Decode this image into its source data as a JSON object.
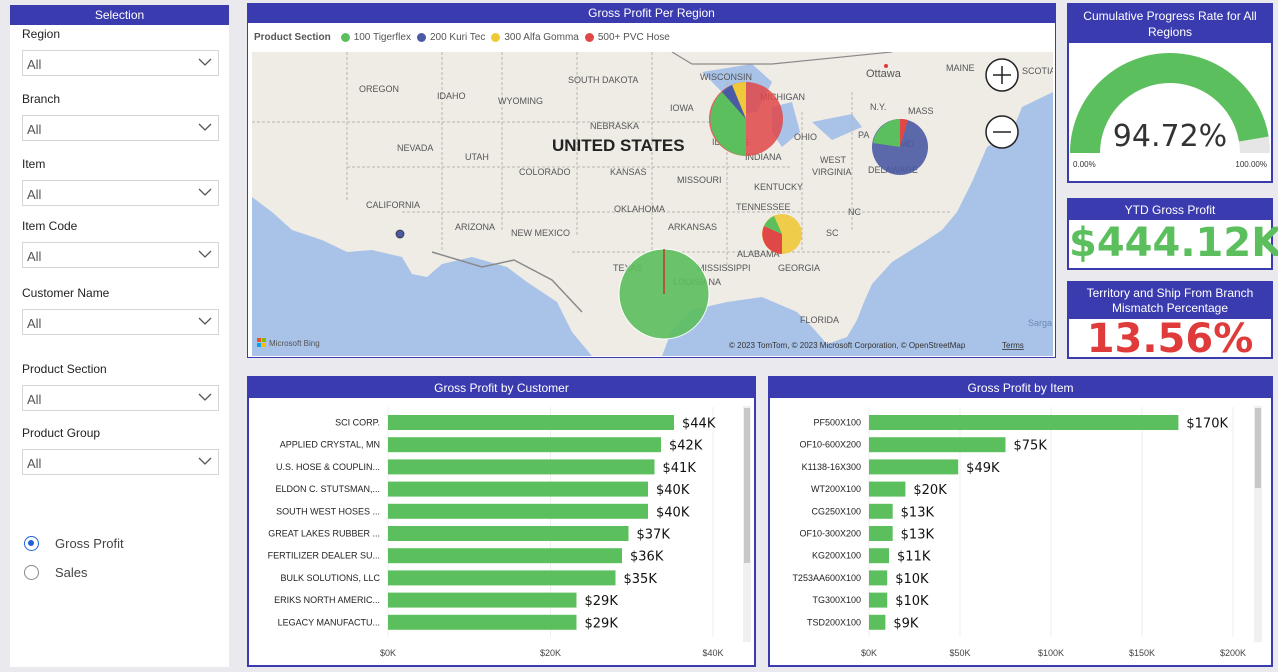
{
  "selection": {
    "title": "Selection",
    "slicers": [
      {
        "label": "Region",
        "value": "All"
      },
      {
        "label": "Branch",
        "value": "All"
      },
      {
        "label": "Item",
        "value": "All"
      },
      {
        "label": "Item Code",
        "value": "All"
      },
      {
        "label": "Customer Name",
        "value": "All"
      },
      {
        "label": "Product Section",
        "value": "All"
      },
      {
        "label": "Product Group",
        "value": "All"
      }
    ],
    "radios": [
      {
        "label": "Gross Profit",
        "selected": true
      },
      {
        "label": "Sales",
        "selected": false
      }
    ]
  },
  "map": {
    "title": "Gross Profit Per Region",
    "legend_title": "Product Section",
    "legend": [
      {
        "label": "100 Tigerflex",
        "color": "#5cbf5e"
      },
      {
        "label": "200 Kuri Tec",
        "color": "#4a5aa3"
      },
      {
        "label": "300 Alfa Gomma",
        "color": "#f0c93a"
      },
      {
        "label": "500+ PVC Hose",
        "color": "#e04848"
      }
    ],
    "labels": {
      "country": "UNITED STATES",
      "states": [
        "OREGON",
        "IDAHO",
        "WYOMING",
        "SOUTH DAKOTA",
        "WISCONSIN",
        "MICHIGAN",
        "IOWA",
        "NEBRASKA",
        "NEVADA",
        "UTAH",
        "COLORADO",
        "KANSAS",
        "MISSOURI",
        "ILLINOIS",
        "INDIANA",
        "OHIO",
        "PA",
        "N.Y.",
        "MASS",
        "MD",
        "DELAWARE",
        "WEST",
        "VIRGINIA",
        "KENTUCKY",
        "CALIFORNIA",
        "ARIZONA",
        "NEW MEXICO",
        "OKLAHOMA",
        "ARKANSAS",
        "TENNESSEE",
        "NC",
        "SC",
        "ALABAMA",
        "GEORGIA",
        "MISSISSIPPI",
        "TEXAS",
        "LOUISIANA",
        "FLORIDA",
        "Ottawa",
        "MAINE",
        "SCOTIA",
        "Sarga"
      ],
      "west_label": "WEST",
      "virginia_label": "VIRGINIA"
    },
    "attribution": "© 2023 TomTom, © 2023 Microsoft Corporation, © OpenStreetMap",
    "terms": "Terms",
    "bing": "Microsoft Bing",
    "zoom_in": "+",
    "zoom_out": "−"
  },
  "gauge": {
    "title": "Cumulative Progress Rate for All Regions",
    "value_text": "94.72%",
    "value": 0.9472,
    "min_label": "0.00%",
    "max_label": "100.00%",
    "fill_color": "#5cbf5e"
  },
  "ytd": {
    "title": "YTD Gross Profit",
    "value": "$444.12K",
    "color": "#5cbf5e"
  },
  "mismatch": {
    "title": "Territory and Ship From Branch Mismatch Percentage",
    "value": "13.56%",
    "color": "#e03b3b"
  },
  "customer_chart": {
    "title": "Gross Profit by Customer",
    "type": "bar",
    "categories": [
      "SCI CORP.",
      "APPLIED CRYSTAL, MN",
      "U.S. HOSE & COUPLIN...",
      "ELDON C. STUTSMAN,...",
      "SOUTH WEST HOSES ...",
      "GREAT LAKES RUBBER ...",
      "FERTILIZER DEALER SU...",
      "BULK SOLUTIONS, LLC",
      "ERIKS NORTH AMERIC...",
      "LEGACY MANUFACTU..."
    ],
    "values": [
      44,
      42,
      41,
      40,
      40,
      37,
      36,
      35,
      29,
      29
    ],
    "value_labels": [
      "$44K",
      "$42K",
      "$41K",
      "$40K",
      "$40K",
      "$37K",
      "$36K",
      "$35K",
      "$29K",
      "$29K"
    ],
    "xticks": [
      "$0K",
      "$20K",
      "$40K"
    ],
    "xlim": [
      0,
      50
    ],
    "color": "#5cbf5e"
  },
  "item_chart": {
    "title": "Gross Profit by Item",
    "type": "bar",
    "categories": [
      "PF500X100",
      "OF10-600X200",
      "K1138-16X300",
      "WT200X100",
      "CG250X100",
      "OF10-300X200",
      "KG200X100",
      "T253AA600X100",
      "TG300X100",
      "TSD200X100"
    ],
    "values": [
      170,
      75,
      49,
      20,
      13,
      13,
      11,
      10,
      10,
      9
    ],
    "value_labels": [
      "$170K",
      "$75K",
      "$49K",
      "$20K",
      "$13K",
      "$13K",
      "$11K",
      "$10K",
      "$10K",
      "$9K"
    ],
    "xticks": [
      "$0K",
      "$50K",
      "$100K",
      "$150K",
      "$200K"
    ],
    "xlim": [
      0,
      200
    ],
    "color": "#5cbf5e"
  }
}
